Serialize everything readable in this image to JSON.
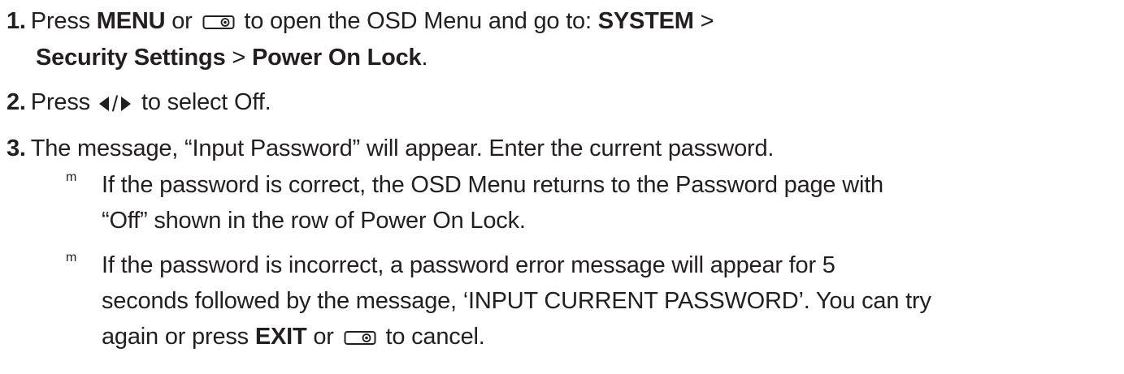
{
  "step1": {
    "number": "1.",
    "t1": "Press ",
    "menu": "MENU",
    "t2": " or ",
    "icon": "remote-button-icon",
    "t3": " to open the OSD Menu and go to: ",
    "system": "SYSTEM",
    "t4": " >",
    "security": "Security Settings",
    "t5": " > ",
    "lock": "Power On Lock",
    "t6": "."
  },
  "step2": {
    "number": "2.",
    "t1": "Press ",
    "left_icon": "left-arrow-icon",
    "slash": "/",
    "right_icon": "right-arrow-icon",
    "t2": " to select Off."
  },
  "step3": {
    "number": "3.",
    "text": "The message, “Input Password” will appear. Enter the current password."
  },
  "bullets": [
    {
      "mark": "m",
      "line1": "If the password is correct, the OSD Menu returns to the Password page with",
      "line2": "“Off” shown in the row of Power On Lock."
    },
    {
      "mark": "m",
      "line1": "If the password is incorrect, a password error message will appear for 5",
      "line2": "seconds followed by the message, ‘INPUT CURRENT PASSWORD’. You can try",
      "line3_t1": "again or press ",
      "line3_exit": "EXIT",
      "line3_t2": " or ",
      "line3_icon": "remote-button-icon",
      "line3_t3": " to cancel."
    }
  ]
}
